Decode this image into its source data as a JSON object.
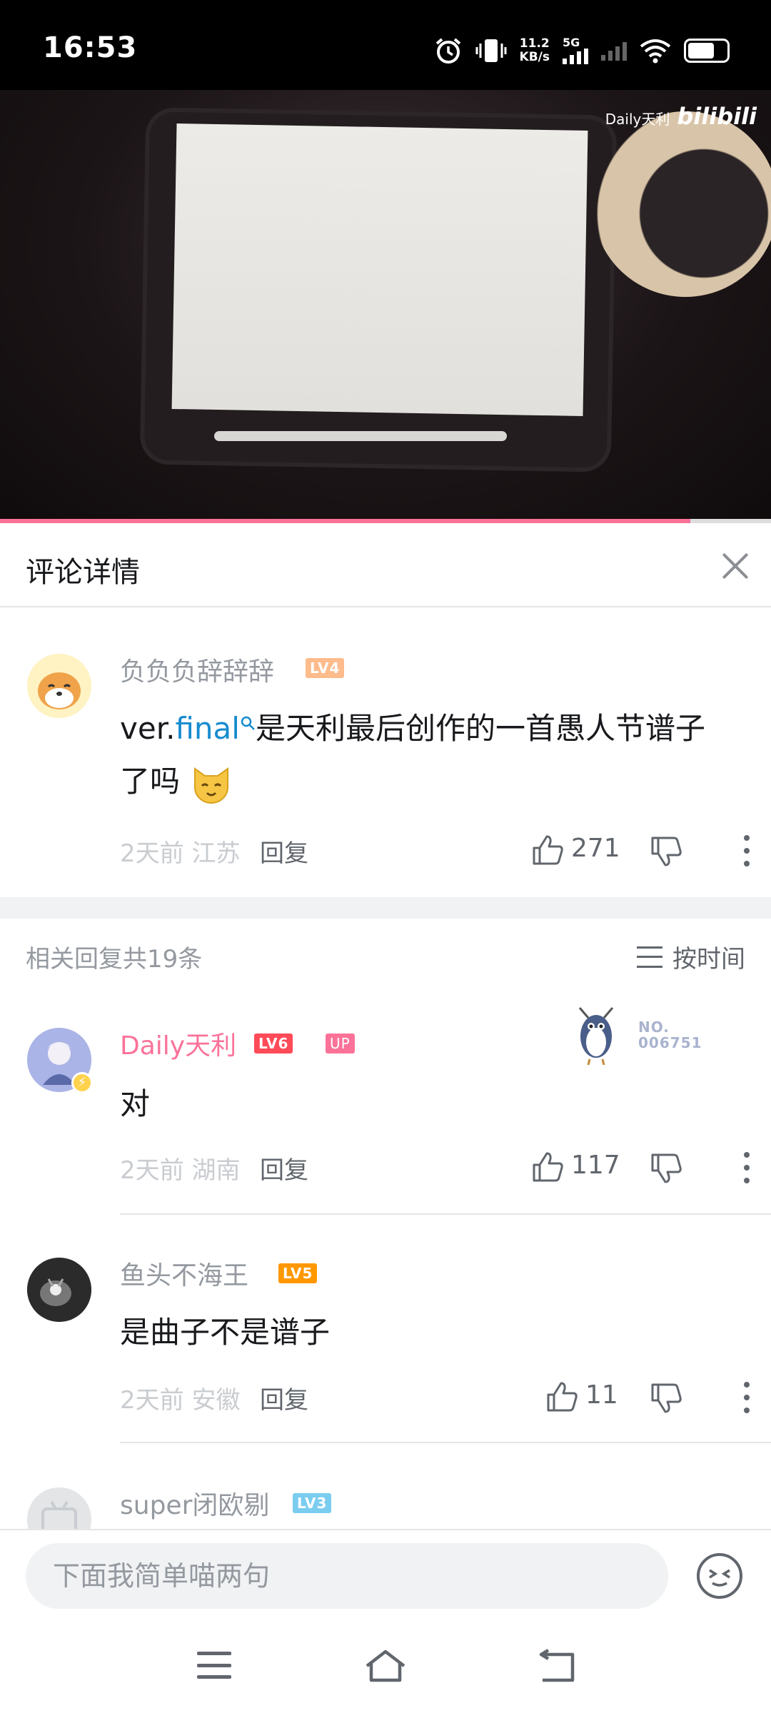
{
  "status_bar": {
    "time": "16:53",
    "net_speed_value": "11.2",
    "net_speed_unit": "KB/s",
    "network": "5G"
  },
  "video": {
    "watermark_text": "Daily天利",
    "watermark_logo": "bilibili",
    "progress": 0.895
  },
  "panel": {
    "title": "评论详情"
  },
  "main_comment": {
    "username": "负负负辞辞辞",
    "level": "LV4",
    "text_prefix": "ver.",
    "link_text": "final",
    "text_suffix": "是天利最后创作的一首愚人节谱子",
    "text_line2": "了吗",
    "time": "2天前",
    "location": "江苏",
    "reply_label": "回复",
    "likes": "271"
  },
  "replies_header": {
    "count_text": "相关回复共19条",
    "sort_label": "按时间"
  },
  "replies": [
    {
      "username": "Daily天利",
      "level": "LV6",
      "up_badge": "UP",
      "fan_badge_no": "NO.",
      "fan_badge_num": "006751",
      "text": "对",
      "time": "2天前",
      "location": "湖南",
      "reply_label": "回复",
      "likes": "117"
    },
    {
      "username": "鱼头不海王",
      "level": "LV5",
      "text": "是曲子不是谱子",
      "time": "2天前",
      "location": "安徽",
      "reply_label": "回复",
      "likes": "11"
    },
    {
      "username": "super闭欧剔",
      "level": "LV3"
    }
  ],
  "input": {
    "placeholder": "下面我简单喵两句"
  },
  "colors": {
    "accent_pink": "#fb7299",
    "link_blue": "#178bcf",
    "lv4": "#febb8b",
    "lv5": "#ff9800",
    "lv6": "#ff4a58",
    "lv3": "#7bcdef"
  }
}
